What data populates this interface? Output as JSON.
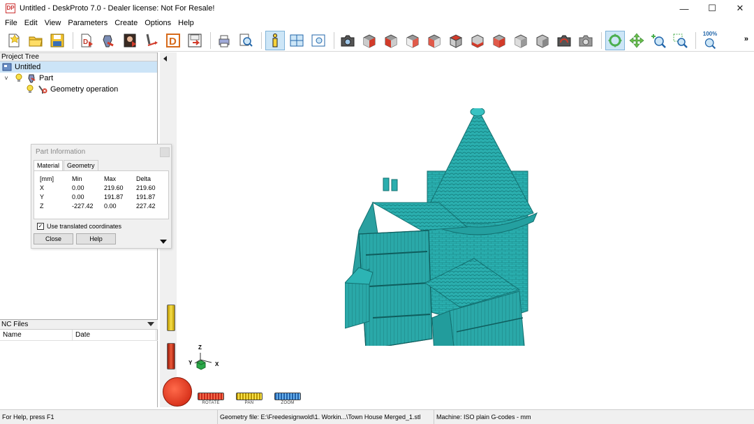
{
  "window": {
    "logo_text": "DP",
    "title": "Untitled - DeskProto 7.0 - Dealer license: Not For Resale!",
    "minimize": "—",
    "maximize": "☐",
    "close": "✕"
  },
  "menu": [
    "File",
    "Edit",
    "View",
    "Parameters",
    "Create",
    "Options",
    "Help"
  ],
  "toolbar": {
    "zoom_label": "100%",
    "more": "»"
  },
  "project_tree": {
    "header": "Project Tree",
    "root": "Untitled",
    "part": "Part",
    "operation": "Geometry operation"
  },
  "nc_files": {
    "header": "NC Files",
    "columns": [
      "Name",
      "Date"
    ]
  },
  "part_info": {
    "title": "Part Information",
    "tabs": [
      "Material",
      "Geometry"
    ],
    "columns": [
      "[mm]",
      "Min",
      "Max",
      "Delta"
    ],
    "rows": [
      [
        "X",
        "0.00",
        "219.60",
        "219.60"
      ],
      [
        "Y",
        "0.00",
        "191.87",
        "191.87"
      ],
      [
        "Z",
        "-227.42",
        "0.00",
        "227.42"
      ]
    ],
    "checkbox_label": "Use translated coordinates",
    "checkbox_checked": true,
    "close_label": "Close",
    "help_label": "Help"
  },
  "viewport": {
    "axis": {
      "x": "X",
      "y": "Y",
      "z": "Z"
    },
    "controls": [
      "ROTATE",
      "PAN",
      "ZOOM"
    ],
    "model_color": "#2aaeae"
  },
  "status": {
    "help": "For Help, press F1",
    "geometry": "Geometry file: E:\\Freedesignwold\\1. Workin...\\Town House Merged_1.stl",
    "machine": "Machine: ISO plain G-codes - mm"
  }
}
